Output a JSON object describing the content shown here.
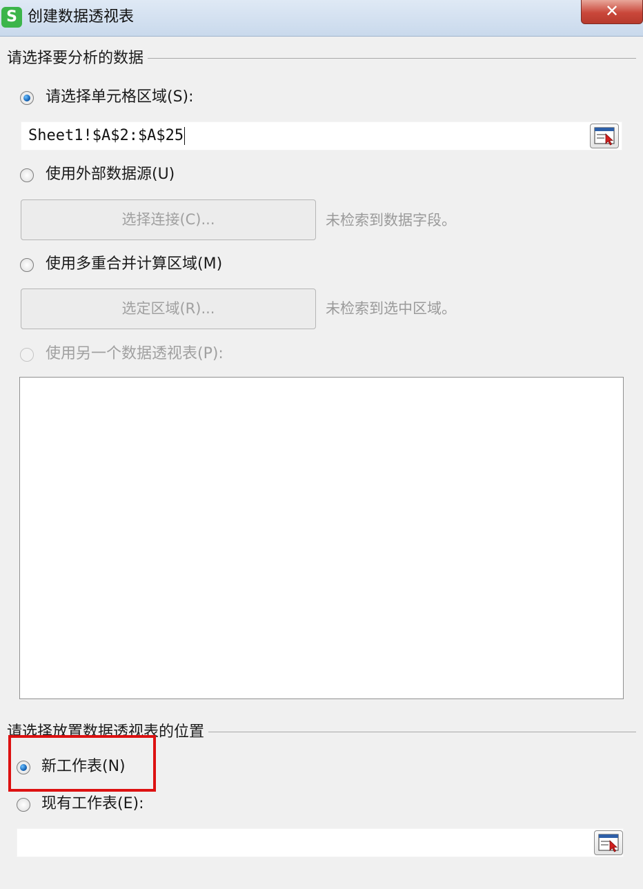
{
  "window": {
    "title": "创建数据透视表",
    "app_icon_letter": "S",
    "close_glyph": "✕"
  },
  "source_section": {
    "heading": "请选择要分析的数据",
    "options": {
      "cell_range": {
        "label": "请选择单元格区域(S):",
        "checked": true,
        "value": "Sheet1!$A$2:$A$25"
      },
      "external_source": {
        "label": "使用外部数据源(U)",
        "checked": false,
        "button_label": "选择连接(C)...",
        "hint": "未检索到数据字段。"
      },
      "multiple_consolidation": {
        "label": "使用多重合并计算区域(M)",
        "checked": false,
        "button_label": "选定区域(R)...",
        "hint": "未检索到选中区域。"
      },
      "another_pivot": {
        "label": "使用另一个数据透视表(P):",
        "checked": false,
        "disabled": true
      }
    }
  },
  "destination_section": {
    "heading": "请选择放置数据透视表的位置",
    "options": {
      "new_worksheet": {
        "label": "新工作表(N)",
        "checked": true
      },
      "existing_worksheet": {
        "label": "现有工作表(E):",
        "checked": false,
        "value": ""
      }
    }
  },
  "colors": {
    "highlight": "#dd1111",
    "app_icon": "#3bb54a",
    "close_button": "#c9473a"
  },
  "icons": [
    "app-logo-icon",
    "close-icon",
    "range-picker-icon"
  ]
}
